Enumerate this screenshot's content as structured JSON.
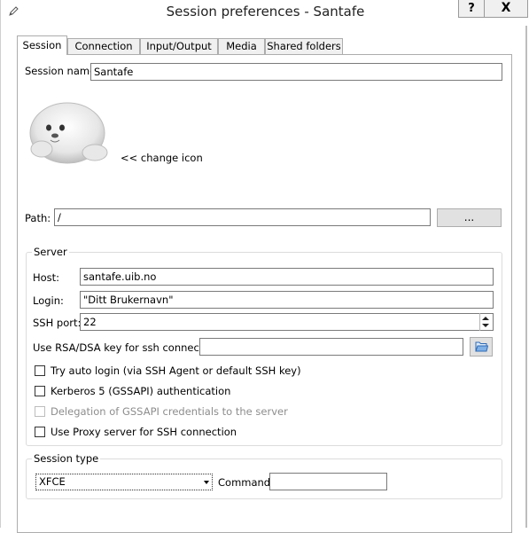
{
  "window": {
    "title": "Session preferences - Santafe",
    "help_label": "?",
    "close_label": "X"
  },
  "tabs": [
    {
      "label": "Session",
      "active": true
    },
    {
      "label": "Connection",
      "active": false
    },
    {
      "label": "Input/Output",
      "active": false
    },
    {
      "label": "Media",
      "active": false
    },
    {
      "label": "Shared folders",
      "active": false
    }
  ],
  "session": {
    "name_label": "Session name:",
    "name_value": "Santafe",
    "change_icon_label": "<< change icon",
    "path_label": "Path:",
    "path_value": "/",
    "browse_label": "..."
  },
  "server": {
    "group_title": "Server",
    "host_label": "Host:",
    "host_value": "santafe.uib.no",
    "login_label": "Login:",
    "login_value": "\"Ditt Brukernavn\"",
    "ssh_port_label": "SSH port:",
    "ssh_port_value": "22",
    "rsa_label": "Use RSA/DSA key for ssh connection:",
    "rsa_value": "",
    "options": [
      {
        "label": "Try auto login (via SSH Agent or default SSH key)",
        "checked": false,
        "disabled": false
      },
      {
        "label": "Kerberos 5 (GSSAPI) authentication",
        "checked": false,
        "disabled": false
      },
      {
        "label": "Delegation of GSSAPI credentials to the server",
        "checked": false,
        "disabled": true
      },
      {
        "label": "Use Proxy server for SSH connection",
        "checked": false,
        "disabled": false
      }
    ]
  },
  "session_type": {
    "group_title": "Session type",
    "selected": "XFCE",
    "command_label": "Command:",
    "command_value": ""
  }
}
